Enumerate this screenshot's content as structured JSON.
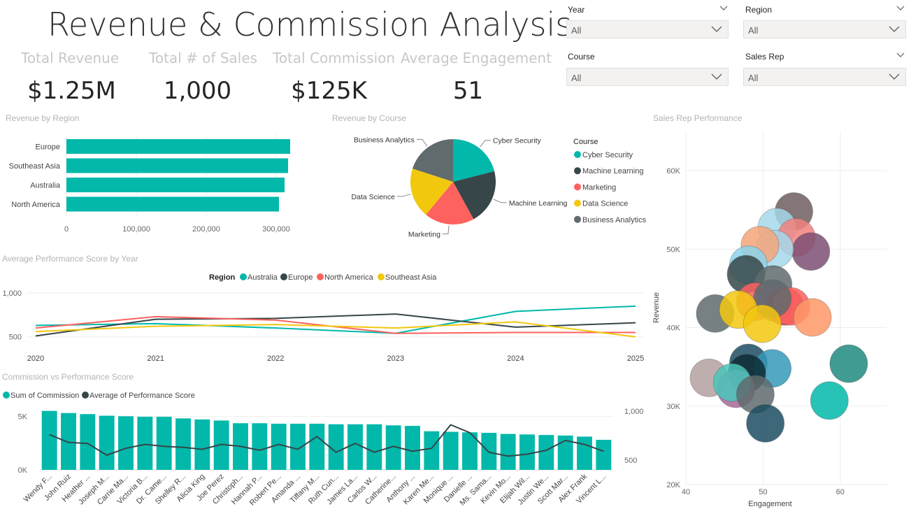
{
  "title": "Revenue & Commission Analysis",
  "kpis": [
    {
      "label": "Total Revenue",
      "value": "$1.25M"
    },
    {
      "label": "Total # of Sales",
      "value": "1,000"
    },
    {
      "label": "Total Commission",
      "value": "$125K"
    },
    {
      "label": "Average Engagement",
      "value": "51"
    }
  ],
  "slicers": [
    {
      "label": "Year",
      "value": "All"
    },
    {
      "label": "Region",
      "value": "All"
    },
    {
      "label": "Course",
      "value": "All"
    },
    {
      "label": "Sales Rep",
      "value": "All"
    }
  ],
  "colors": {
    "teal": "#01b8aa",
    "dark": "#374649",
    "coral": "#fd625e",
    "yellow": "#f2c80f",
    "gray": "#5f6b6d"
  },
  "region_chart": {
    "title": "Revenue by Region",
    "categories": [
      "Europe",
      "Southeast Asia",
      "Australia",
      "North America"
    ],
    "values": [
      320000,
      317000,
      312000,
      304000
    ],
    "xticks": [
      "0",
      "100,000",
      "200,000",
      "300,000"
    ],
    "xtick_values": [
      0,
      100000,
      200000,
      300000
    ],
    "xmax": 330000
  },
  "course_chart": {
    "title": "Revenue by Course",
    "legend_title": "Course",
    "slices": [
      {
        "name": "Cyber Security",
        "value": 21,
        "color": "#01b8aa"
      },
      {
        "name": "Machine Learning",
        "value": 21,
        "color": "#374649"
      },
      {
        "name": "Marketing",
        "value": 19,
        "color": "#fd625e"
      },
      {
        "name": "Data Science",
        "value": 19,
        "color": "#f2c80f"
      },
      {
        "name": "Business Analytics",
        "value": 20,
        "color": "#5f6b6d"
      }
    ]
  },
  "year_chart": {
    "title": "Average Performance Score by Year",
    "legend_title": "Region",
    "x": [
      "2020",
      "2021",
      "2022",
      "2023",
      "2024",
      "2025"
    ],
    "yticks": [
      "1,000",
      "500"
    ],
    "ytick_values": [
      1000,
      500
    ],
    "ylim": [
      450,
      1000
    ],
    "series": [
      {
        "name": "Australia",
        "color": "#01b8aa",
        "values": [
          630,
          650,
          600,
          540,
          790,
          850
        ]
      },
      {
        "name": "Europe",
        "color": "#374649",
        "values": [
          510,
          700,
          710,
          760,
          610,
          660
        ]
      },
      {
        "name": "North America",
        "color": "#fd625e",
        "values": [
          600,
          730,
          690,
          540,
          550,
          550
        ]
      },
      {
        "name": "Southeast Asia",
        "color": "#f2c80f",
        "values": [
          560,
          620,
          640,
          600,
          670,
          500
        ]
      }
    ]
  },
  "commission_chart": {
    "title": "Commission  vs Performance Score",
    "legend": [
      {
        "name": "Sum of Commission",
        "color": "#01b8aa"
      },
      {
        "name": "Average of Performance Score",
        "color": "#374649"
      }
    ],
    "categories": [
      "Wendy F...",
      "John Ruiz",
      "Heather ...",
      "Joseph M...",
      "Carrie Ma...",
      "Victoria B...",
      "Dr. Came...",
      "Shelley R...",
      "Alicia King",
      "Joe Perez",
      "Christoph...",
      "Hannah P...",
      "Robert Pe...",
      "Amanda ...",
      "Tiffany M...",
      "Ruth Cun...",
      "James La...",
      "Carlos W...",
      "Catherine...",
      "Anthony ...",
      "Karen Me...",
      "Monique ...",
      "Danielle ...",
      "Ms. Sama...",
      "Kevin Mo...",
      "Elijah Wil...",
      "Justin We...",
      "Scott Mar...",
      "Alex Frank",
      "Vincent L..."
    ],
    "commission": [
      5500,
      5300,
      5200,
      5050,
      5000,
      4950,
      4950,
      4800,
      4700,
      4600,
      4350,
      4350,
      4300,
      4300,
      4300,
      4250,
      4250,
      4250,
      4150,
      4100,
      3600,
      3550,
      3500,
      3450,
      3350,
      3300,
      3250,
      3200,
      3100,
      2800
    ],
    "score": [
      760,
      680,
      670,
      550,
      620,
      660,
      640,
      630,
      610,
      660,
      640,
      600,
      660,
      610,
      740,
      580,
      670,
      580,
      640,
      590,
      620,
      860,
      780,
      580,
      540,
      560,
      600,
      700,
      660,
      590
    ],
    "y_left_ticks": [
      "5K",
      "0K"
    ],
    "y_left_values": [
      5000,
      0
    ],
    "y_left_max": 6000,
    "y_right_ticks": [
      "1,000",
      "500"
    ],
    "y_right_values": [
      1000,
      500
    ],
    "y_right_lim": [
      500,
      1000
    ]
  },
  "scatter_chart": {
    "title": "Sales Rep Performance",
    "xlabel": "Engagement",
    "ylabel": "Revenue",
    "xticks": [
      "40",
      "50",
      "60"
    ],
    "xtick_values": [
      40,
      50,
      60
    ],
    "xlim": [
      40,
      66
    ],
    "yticks": [
      "20K",
      "30K",
      "40K",
      "50K",
      "60K"
    ],
    "ytick_values": [
      20000,
      30000,
      40000,
      50000,
      60000
    ],
    "ylim": [
      20000,
      65000
    ],
    "points": [
      {
        "x": 54.0,
        "y": 54800,
        "color": "#6f5e5e"
      },
      {
        "x": 51.8,
        "y": 52800,
        "color": "#a5d8ea"
      },
      {
        "x": 54.3,
        "y": 51500,
        "color": "#f1817e"
      },
      {
        "x": 56.2,
        "y": 49700,
        "color": "#7d4f73"
      },
      {
        "x": 51.5,
        "y": 50000,
        "color": "#a5d8ea"
      },
      {
        "x": 49.6,
        "y": 50500,
        "color": "#f4a479"
      },
      {
        "x": 48.1,
        "y": 48000,
        "color": "#8ad4eb"
      },
      {
        "x": 47.8,
        "y": 46800,
        "color": "#374649"
      },
      {
        "x": 51.3,
        "y": 45500,
        "color": "#5f6b6d"
      },
      {
        "x": 49.0,
        "y": 43300,
        "color": "#fd625e"
      },
      {
        "x": 51.5,
        "y": 43200,
        "color": "#a66999"
      },
      {
        "x": 52.8,
        "y": 42700,
        "color": "#d64550"
      },
      {
        "x": 53.6,
        "y": 42700,
        "color": "#fd625e"
      },
      {
        "x": 51.2,
        "y": 43700,
        "color": "#5f6b6d"
      },
      {
        "x": 56.4,
        "y": 41300,
        "color": "#fe9666"
      },
      {
        "x": 43.8,
        "y": 41800,
        "color": "#5f6b6d"
      },
      {
        "x": 46.8,
        "y": 42300,
        "color": "#f2c80f"
      },
      {
        "x": 49.9,
        "y": 40500,
        "color": "#f2c80f"
      },
      {
        "x": 48.1,
        "y": 35500,
        "color": "#1c4e63"
      },
      {
        "x": 51.2,
        "y": 34800,
        "color": "#3599b8"
      },
      {
        "x": 47.9,
        "y": 34200,
        "color": "#0d2c36"
      },
      {
        "x": 43.0,
        "y": 33600,
        "color": "#b4a0a0"
      },
      {
        "x": 46.5,
        "y": 32200,
        "color": "#a66999"
      },
      {
        "x": 46.0,
        "y": 33000,
        "color": "#4ac5bb"
      },
      {
        "x": 49.0,
        "y": 31500,
        "color": "#5f6b6d"
      },
      {
        "x": 50.3,
        "y": 27800,
        "color": "#1c4e63"
      },
      {
        "x": 58.6,
        "y": 30700,
        "color": "#01b8aa"
      },
      {
        "x": 61.1,
        "y": 35400,
        "color": "#1e8a80"
      }
    ]
  }
}
